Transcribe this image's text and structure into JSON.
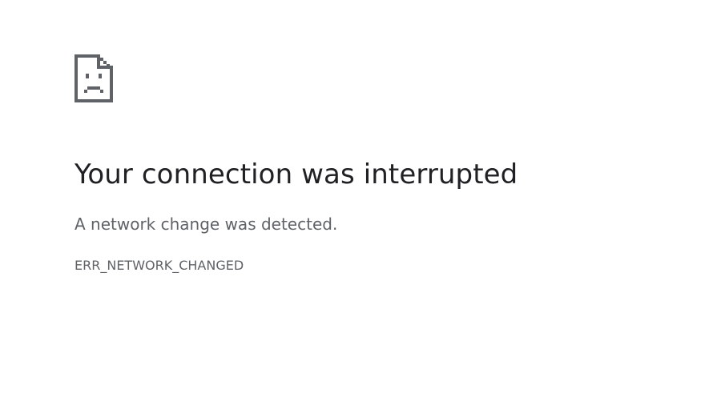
{
  "error_page": {
    "icon": "sad-document-icon",
    "title": "Your connection was interrupted",
    "message": "A network change was detected.",
    "error_code": "ERR_NETWORK_CHANGED"
  },
  "colors": {
    "title": "#202124",
    "text": "#5f6368",
    "icon": "#5f6368",
    "background": "#ffffff"
  }
}
